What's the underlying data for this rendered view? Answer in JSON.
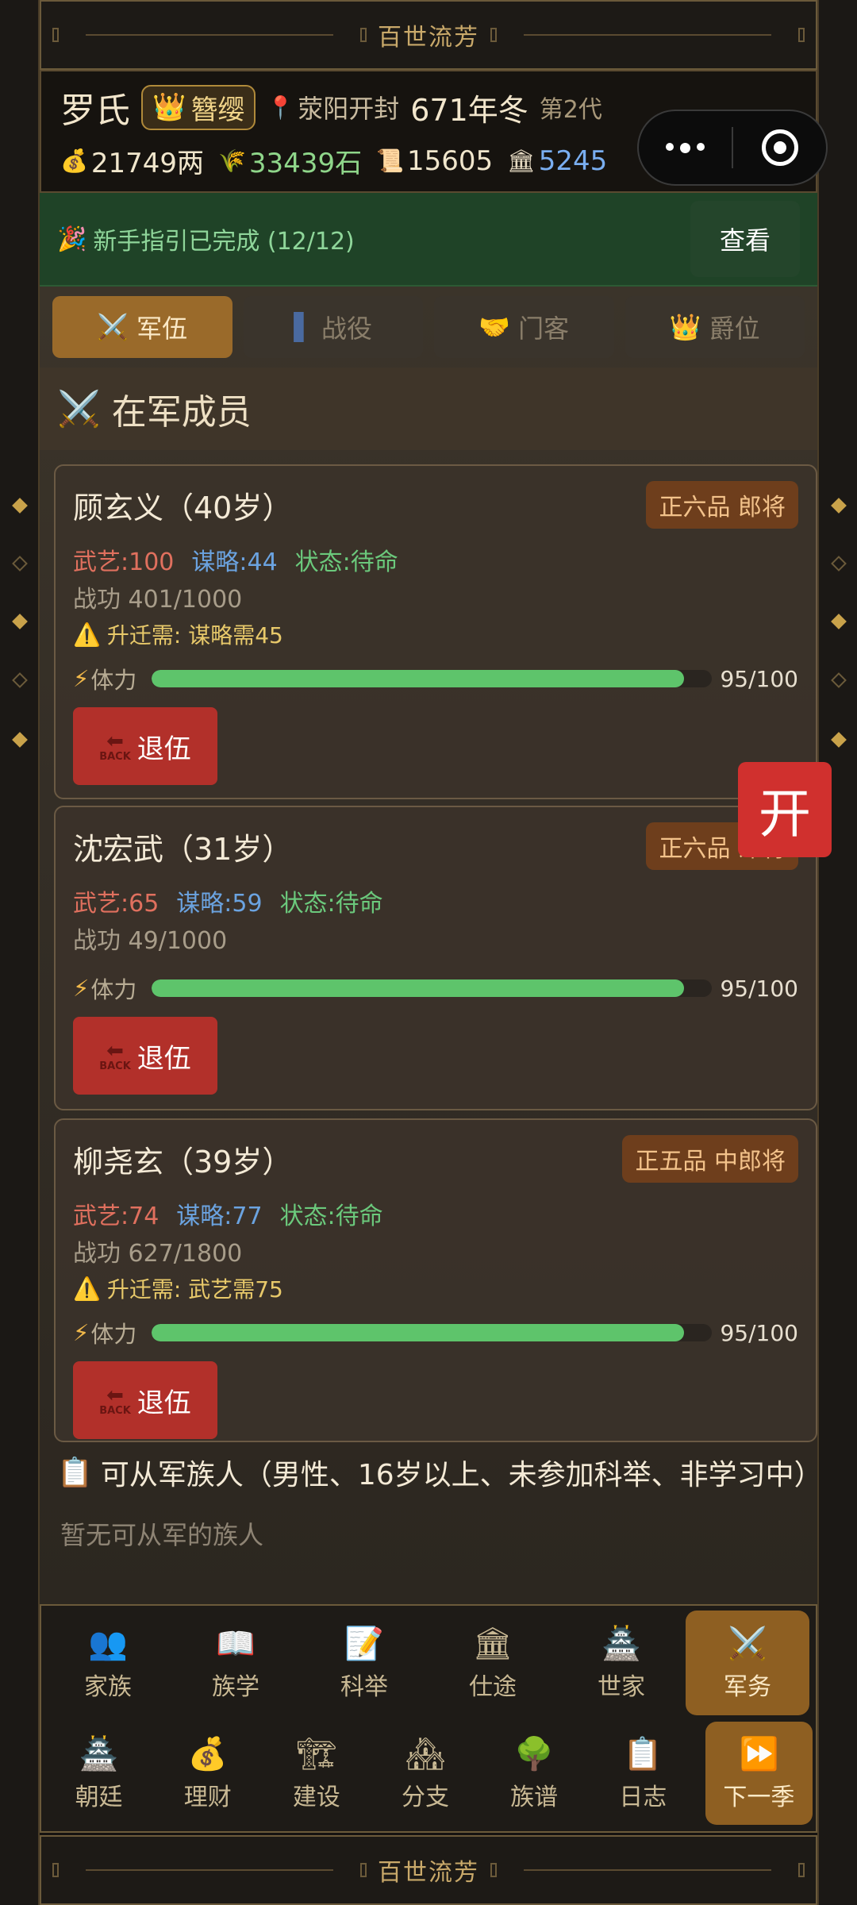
{
  "banner_title": "百世流芳",
  "header": {
    "surname": "罗氏",
    "title_icon": "crown-icon",
    "title": "簪缨",
    "location_icon": "pin-icon",
    "location": "荥阳开封",
    "year": "671年冬",
    "generation": "第2代",
    "resources": {
      "silver": "21749两",
      "grain": "33439石",
      "scroll": "15605",
      "prestige": "5245"
    },
    "colors": {
      "silver": "#f0e6cc",
      "grain": "#8fd68a",
      "scroll": "#f0e6cc",
      "prestige": "#7aaef0"
    }
  },
  "guide": {
    "text": "新手指引已完成 (12/12)",
    "button": "查看"
  },
  "tabs": [
    {
      "label": "军伍",
      "icon": "crossed-swords-icon"
    },
    {
      "label": "战役",
      "icon": "flag-icon"
    },
    {
      "label": "门客",
      "icon": "handshake-icon"
    },
    {
      "label": "爵位",
      "icon": "crown-icon"
    }
  ],
  "section_title": "在军成员",
  "members": [
    {
      "name": "顾玄义（40岁）",
      "rank": "正六品 郎将",
      "wuyi": "武艺:100",
      "moulue": "谋略:44",
      "status": "状态:待命",
      "merit": "战功 401/1000",
      "warning": "升迁需: 谋略需45",
      "stamina_label": "体力",
      "stamina_value": "95/100",
      "stamina_fraction": 0.95,
      "retire": "退伍"
    },
    {
      "name": "沈宏武（31岁）",
      "rank": "正六品 郎将",
      "wuyi": "武艺:65",
      "moulue": "谋略:59",
      "status": "状态:待命",
      "merit": "战功 49/1000",
      "warning": "",
      "stamina_label": "体力",
      "stamina_value": "95/100",
      "stamina_fraction": 0.95,
      "retire": "退伍"
    },
    {
      "name": "柳尧玄（39岁）",
      "rank": "正五品 中郎将",
      "wuyi": "武艺:74",
      "moulue": "谋略:77",
      "status": "状态:待命",
      "merit": "战功 627/1800",
      "warning": "升迁需: 武艺需75",
      "stamina_label": "体力",
      "stamina_value": "95/100",
      "stamina_fraction": 0.95,
      "retire": "退伍"
    }
  ],
  "open_button": "开",
  "eligible_title": "可从军族人（男性、16岁以上、未参加科举、非学习中）",
  "eligible_empty": "暂无可从军的族人",
  "nav_row1": [
    {
      "label": "家族",
      "icon": "family-icon"
    },
    {
      "label": "族学",
      "icon": "book-icon"
    },
    {
      "label": "科举",
      "icon": "memo-icon"
    },
    {
      "label": "仕途",
      "icon": "government-icon"
    },
    {
      "label": "世家",
      "icon": "castle-icon"
    },
    {
      "label": "军务",
      "icon": "crossed-swords-icon"
    }
  ],
  "nav_row2": [
    {
      "label": "朝廷",
      "icon": "pagoda-icon"
    },
    {
      "label": "理财",
      "icon": "money-bag-icon"
    },
    {
      "label": "建设",
      "icon": "crane-icon"
    },
    {
      "label": "分支",
      "icon": "houses-icon"
    },
    {
      "label": "族谱",
      "icon": "tree-icon"
    },
    {
      "label": "日志",
      "icon": "clipboard-icon"
    },
    {
      "label": "下一季",
      "icon": "fast-forward-icon"
    }
  ]
}
